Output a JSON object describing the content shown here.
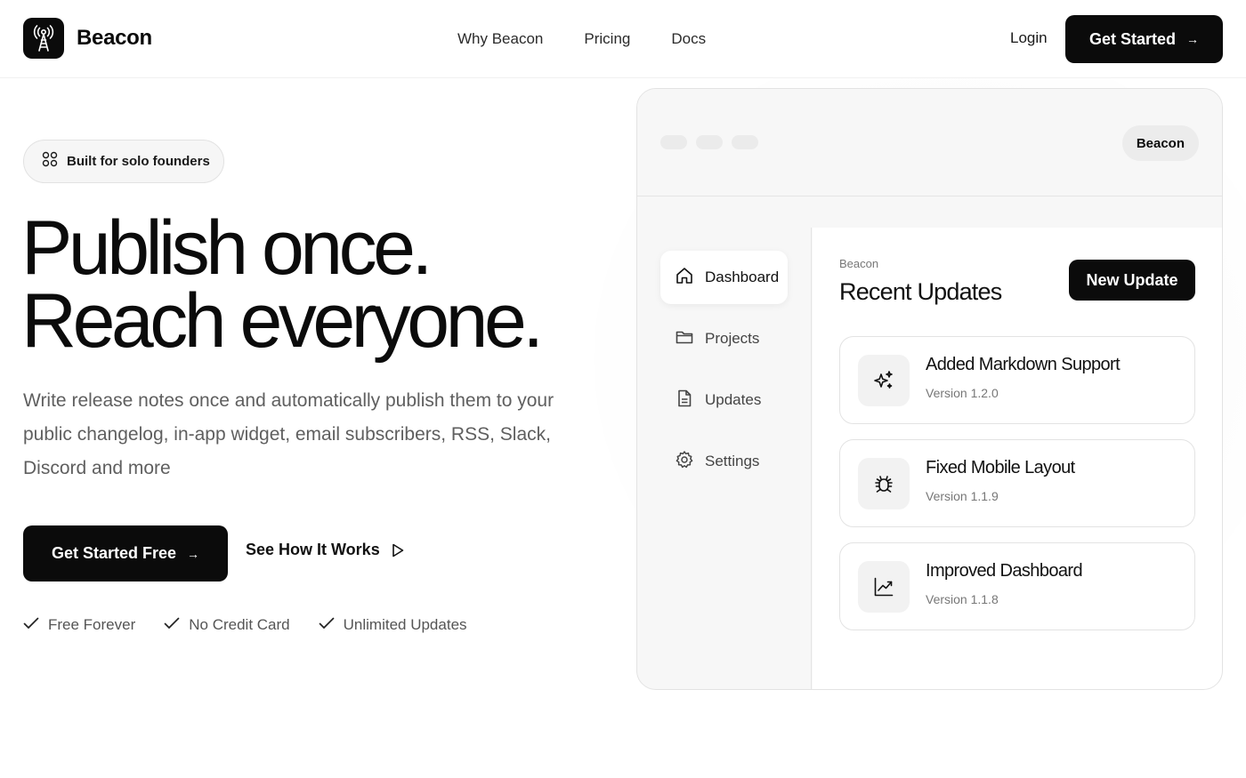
{
  "nav": {
    "brand": "Beacon",
    "links": [
      "Why Beacon",
      "Pricing",
      "Docs"
    ],
    "login": "Login",
    "cta": "Get Started"
  },
  "hero": {
    "badge": "Built for solo founders",
    "headline_line1": "Publish once.",
    "headline_line2": "Reach everyone.",
    "subtext": "Write release notes once and automatically publish them to your public changelog, in-app widget, email subscribers, RSS, Slack, Discord and more",
    "cta_primary": "Get Started Free",
    "cta_secondary": "See How It Works",
    "checks": [
      "Free Forever",
      "No Credit Card",
      "Unlimited Updates"
    ]
  },
  "mockup": {
    "badge": "Beacon",
    "sidebar": [
      {
        "label": "Dashboard",
        "icon": "home-icon",
        "active": true
      },
      {
        "label": "Projects",
        "icon": "folder-icon",
        "active": false
      },
      {
        "label": "Updates",
        "icon": "document-icon",
        "active": false
      },
      {
        "label": "Settings",
        "icon": "gear-icon",
        "active": false
      }
    ],
    "section_label": "Beacon",
    "title": "Recent Updates",
    "new_update": "New Update",
    "updates": [
      {
        "title": "Added Markdown Support",
        "version": "Version 1.2.0",
        "icon": "sparkles-icon"
      },
      {
        "title": "Fixed Mobile Layout",
        "version": "Version 1.1.9",
        "icon": "bug-icon"
      },
      {
        "title": "Improved Dashboard",
        "version": "Version 1.1.8",
        "icon": "chart-icon"
      }
    ]
  },
  "colors": {
    "primary": "#0b0b0b",
    "muted_text": "#5f5f5f",
    "panel": "#f7f7f7",
    "border": "#e3e3e3"
  }
}
